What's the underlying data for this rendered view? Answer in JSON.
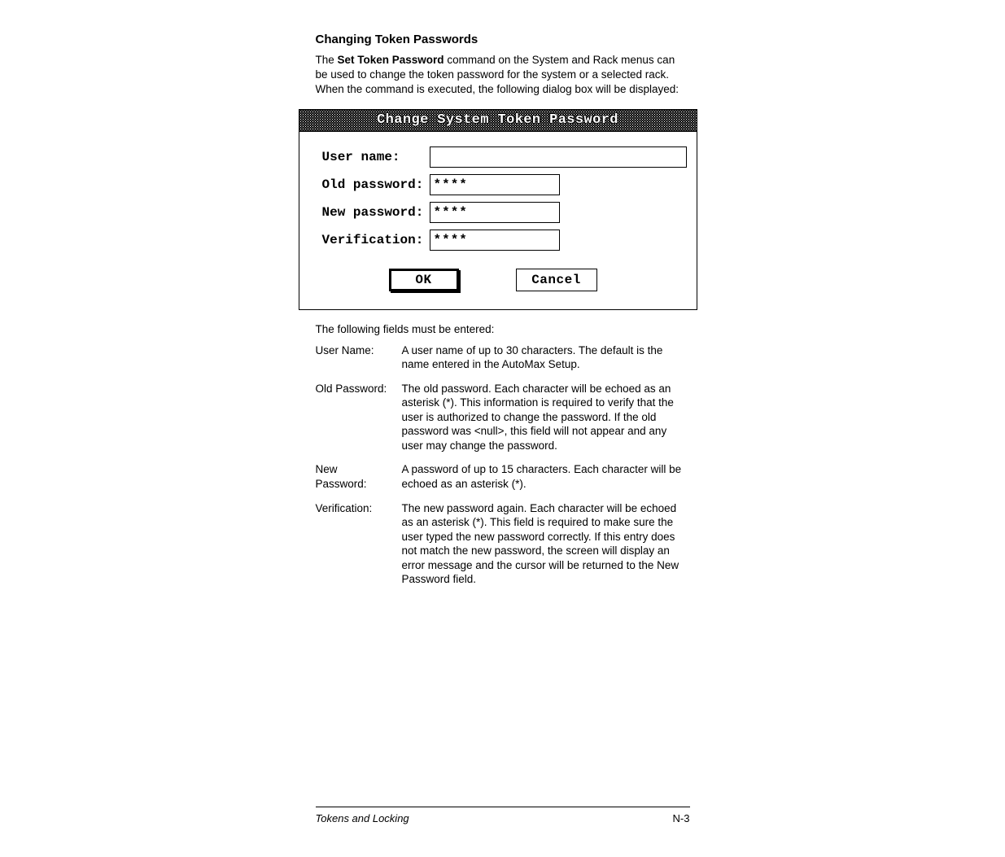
{
  "heading": "Changing Token Passwords",
  "intro_prefix": "The ",
  "intro_bold": "Set Token Password",
  "intro_suffix": " command on the System and Rack menus can be used to change the token password for the system or a selected rack. When the command is executed, the following dialog box will be displayed:",
  "dialog": {
    "title": "Change System Token Password",
    "fields": {
      "username": {
        "label": "User name:",
        "value": ""
      },
      "oldpass": {
        "label": "Old password:",
        "value": "****"
      },
      "newpass": {
        "label": "New password:",
        "value": "****"
      },
      "verify": {
        "label": "Verification:",
        "value": "****"
      }
    },
    "buttons": {
      "ok": "OK",
      "cancel": "Cancel"
    }
  },
  "after_fields": "The following fields must be entered:",
  "defs": {
    "username": {
      "term": "User Name:",
      "desc": "A user name of up to 30 characters. The default is  the name entered in the AutoMax Setup."
    },
    "oldpass": {
      "term": "Old Password:",
      "desc": "The old password. Each character will be echoed as an asterisk (*). This information is required to verify that the user is authorized to change the password. If the old password was <null>, this field will not appear and any user may change the password."
    },
    "newpass": {
      "term": "New Password:",
      "desc": "A password of up to 15 characters. Each character will be echoed as an asterisk (*)."
    },
    "verify": {
      "term": "Verification:",
      "desc": "The new password again. Each character will be echoed as an asterisk (*). This field is required to make sure the user typed the new password correctly. If this entry does not match the new password, the screen will display an error message and the cursor will be returned to the New Password field."
    }
  },
  "footer": {
    "left": "Tokens and Locking",
    "right": "N-3"
  }
}
